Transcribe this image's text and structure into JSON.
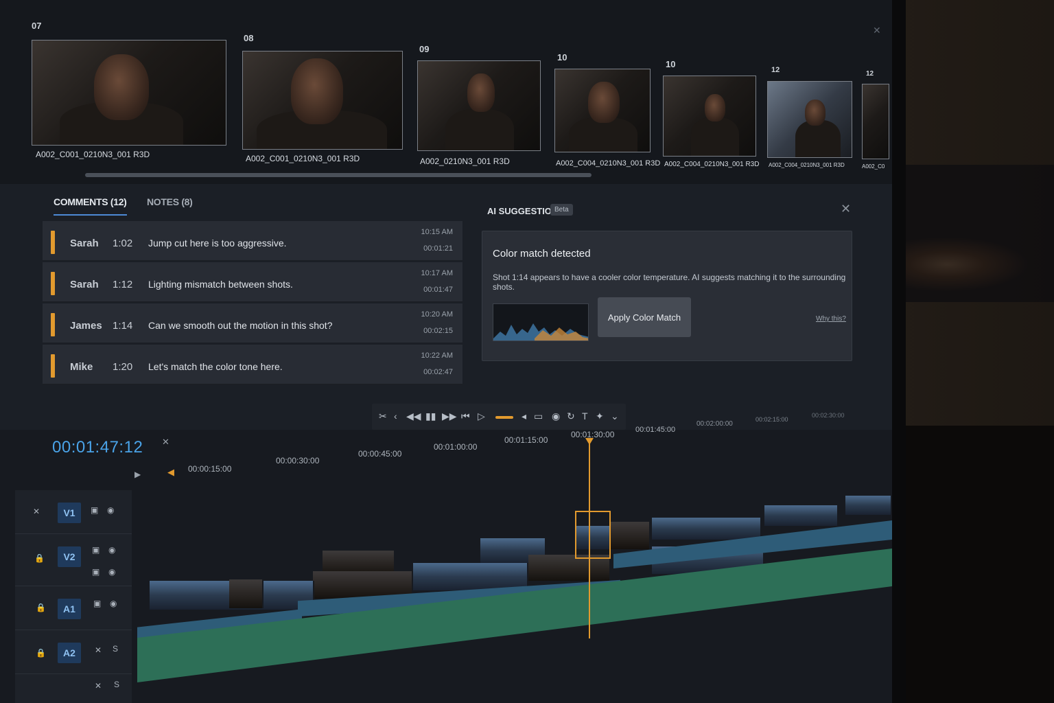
{
  "thumbnails": [
    {
      "num": "07",
      "name": "A002_C001_0210N3_001 R3D"
    },
    {
      "num": "08",
      "name": "A002_C001_0210N3_001 R3D"
    },
    {
      "num": "09",
      "name": "A002_0210N3_001 R3D"
    },
    {
      "num": "10",
      "name": "A002_C004_0210N3_001   R3D"
    },
    {
      "num": "10",
      "name": "A002_C004_0210N3_001 R3D"
    },
    {
      "num": "12",
      "name": "A002_C004_0210N3_001 R3D"
    },
    {
      "num": "12",
      "name": "A002_C0"
    }
  ],
  "comments_panel": {
    "tabs": [
      {
        "label": "COMMENTS (12)"
      },
      {
        "label": "NOTES (8)"
      }
    ],
    "rows": [
      {
        "author": "Sarah",
        "tc": "1:02",
        "text": "Jump cut here is too aggressive.",
        "time": "10:15 AM",
        "dur": "00:01:21"
      },
      {
        "author": "Sarah",
        "tc": "1:12",
        "text": "Lighting mismatch between shots.",
        "time": "10:17 AM",
        "dur": "00:01:47"
      },
      {
        "author": "James",
        "tc": "1:14",
        "text": "Can we smooth out the motion in this shot?",
        "time": "10:20 AM",
        "dur": "00:02:15"
      },
      {
        "author": "Mike",
        "tc": "1:20",
        "text": "Let's match the color tone here.",
        "time": "10:22 AM",
        "dur": "00:02:47"
      }
    ]
  },
  "ai_panel": {
    "title": "AI SUGGESTION",
    "badge": "Beta",
    "card_title": "Color match detected",
    "card_text": "Shot 1:14 appears to have a cooler color temperature. AI suggests matching it to the surrounding shots.",
    "apply_label": "Apply Color Match",
    "why_label": "Why this?"
  },
  "timeline": {
    "timecode": "00:01:47:12",
    "ruler": [
      "00:00:15:00",
      "00:00:30:00",
      "00:00:45:00",
      "00:01:00:00",
      "00:01:15:00",
      "00:01:30:00",
      "00:01:45:00",
      "00:02:00:00",
      "00:02:15:00",
      "00:02:30:00"
    ],
    "tracks": [
      {
        "label": "V1"
      },
      {
        "label": "V2"
      },
      {
        "label": "A1"
      },
      {
        "label": "A2"
      }
    ]
  },
  "colors": {
    "accent": "#e29a2e",
    "timecode": "#4aa3e8",
    "audio": "#2e5c78",
    "audio_green": "#2d6f57"
  }
}
